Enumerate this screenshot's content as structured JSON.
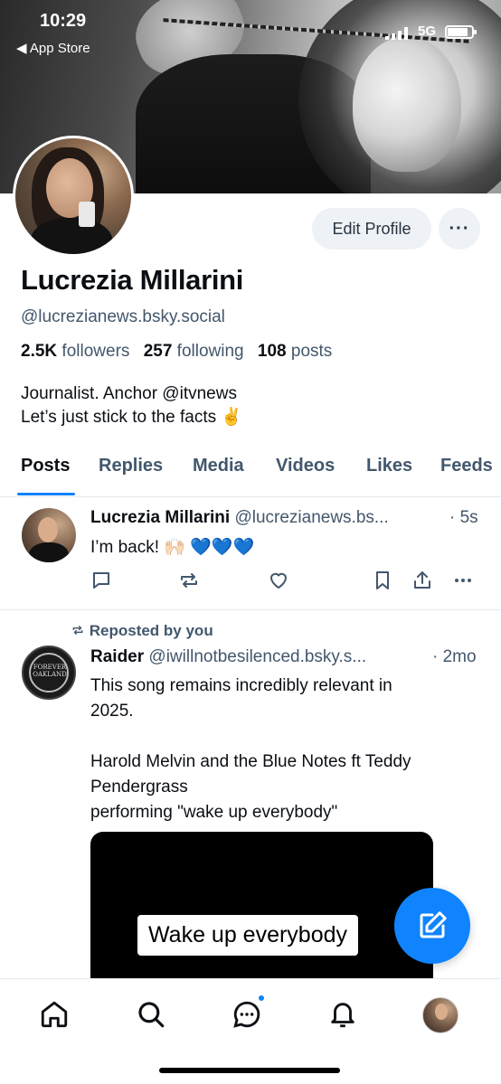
{
  "status_bar": {
    "time": "10:29",
    "back_app": "◀ App Store",
    "network": "5G",
    "battery_level": 0.85
  },
  "profile": {
    "display_name": "Lucrezia Millarini",
    "handle": "@lucrezianews.bsky.social",
    "edit_button": "Edit Profile",
    "more_button": "···",
    "stats": [
      {
        "count": "2.5K",
        "label": "followers"
      },
      {
        "count": "257",
        "label": "following"
      },
      {
        "count": "108",
        "label": "posts"
      }
    ],
    "bio_line1": "Journalist. Anchor @itvnews",
    "bio_line2": "Let’s just stick to the facts ✌️"
  },
  "tabs": [
    "Posts",
    "Replies",
    "Media",
    "Videos",
    "Likes",
    "Feeds"
  ],
  "active_tab": "Posts",
  "posts": [
    {
      "author": "Lucrezia Millarini",
      "handle": "@lucrezianews.bs...",
      "time": "· 5s",
      "text": "I’m back! 🙌🏻",
      "hearts": "💙💙💙"
    },
    {
      "repost_label": "Reposted by you",
      "author": "Raider",
      "handle": "@iwillnotbesilenced.bsky.s...",
      "time": "· 2mo",
      "avatar_text": "FOREVER OAKLAND",
      "text_lines": [
        "This song remains incredibly relevant in",
        "2025.",
        "",
        "Harold Melvin and the Blue Notes ft Teddy",
        "Pendergrass",
        "performing \"wake up everybody\""
      ],
      "video_caption": "Wake up everybody"
    }
  ],
  "icons": {
    "reply": "reply-icon",
    "repost": "repost-icon",
    "like": "heart-icon",
    "bookmark": "bookmark-icon",
    "share": "share-icon",
    "more": "more-icon",
    "compose": "compose-icon",
    "nav": [
      "home-icon",
      "search-icon",
      "chat-icon",
      "bell-icon",
      "profile-avatar"
    ]
  },
  "colors": {
    "accent": "#1083fe",
    "text_muted": "#42576c",
    "heart_blue": "#1a7cf2"
  }
}
